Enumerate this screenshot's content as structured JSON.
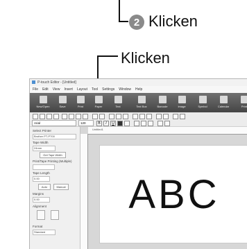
{
  "callouts": {
    "step2_number": "2",
    "step2_label": "Klicken",
    "arrow_label": "Klicken"
  },
  "app": {
    "title": "P-touch Editor - [Untitled]",
    "menu": [
      "File",
      "Edit",
      "View",
      "Insert",
      "Layout",
      "Tool",
      "Settings",
      "Window",
      "Help"
    ],
    "ribbon_buttons": [
      "New/Open",
      "Save",
      "Print",
      "Paper",
      "Text",
      "Text Box",
      "Barcode",
      "Image",
      "Symbol",
      "Calendar",
      "Print"
    ],
    "font_name": "Arial",
    "font_size": "120",
    "document_tab": "Untitled1",
    "sidebar": {
      "printer_label": "Select Printer",
      "printer_value": "Brother PT-P700",
      "tape_width_label": "Tape Width",
      "tape_width_value": "24mm",
      "get_tape_width_button": "Get Tape Width",
      "print_mode_label": "Print/Tape Printing (Multiple)",
      "tape_length_label": "Tape Length",
      "tape_length_value": "0.00",
      "auto_button": "Auto",
      "manual_button": "Manual",
      "margins_label": "Margins",
      "margins_value": "0.00",
      "alignment_label": "Alignment",
      "format_label": "Format",
      "format_value": "Standard"
    },
    "label_text": "ABC"
  }
}
